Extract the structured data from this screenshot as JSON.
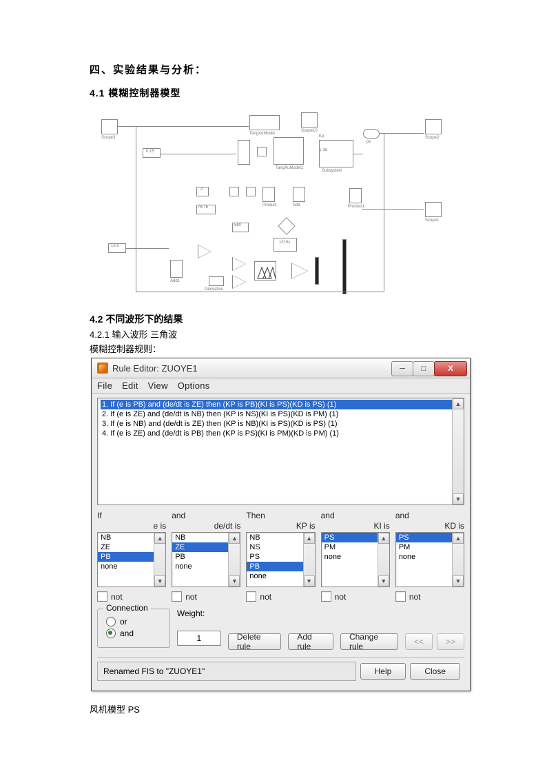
{
  "headings": {
    "section4": "四、实验结果与分析：",
    "s41": "4.1 模糊控制器模型",
    "s42": "4.2 不同波形下的结果",
    "s421": "4.2.1 输入波形 三角波",
    "ruleLabel": "模糊控制器规则：",
    "footer": "风机模型  PS"
  },
  "diagram_labels": {
    "scope3": "Scope3",
    "scope2": "Scope2",
    "scope1": "Scope1",
    "scope10": "Scope10",
    "add": "Add",
    "add1": "Add1",
    "product": "Product",
    "product1": "Product1",
    "derivative": "Derivative",
    "subsystem": "Subsystem",
    "kp": "Kp",
    "u3d": "u·3d",
    "const": "2",
    "const2": "76.76",
    "const3": "580",
    "const4": "0.15",
    "const5": "16.6",
    "tf": "1/0.5s",
    "tangxumodel": "TangXuModel",
    "tangxumodel1": "TangXuModel1",
    "pv": "pv"
  },
  "dialog": {
    "title": "Rule Editor: ZUOYE1",
    "menus": [
      "File",
      "Edit",
      "View",
      "Options"
    ],
    "win": {
      "min": "─",
      "max": "□",
      "close": "X"
    },
    "rules": [
      "1. If (e is PB) and (de/dt is ZE) then (KP is PB)(KI is PS)(KD is PS) (1)",
      "2. If (e is ZE) and (de/dt is NB) then (KP is NS)(KI is PS)(KD is PM) (1)",
      "3. If (e is NB) and (de/dt is ZE) then (KP is NB)(KI is PS)(KD is PS) (1)",
      "4. If (e is ZE) and (de/dt is PB) then (KP is PS)(KI is PM)(KD is PM) (1)"
    ],
    "ruleSelected": 0,
    "cols": [
      {
        "top": "If",
        "sub": "e is",
        "items": [
          "NB",
          "ZE",
          "PB",
          "none"
        ],
        "sel": [
          "PB"
        ]
      },
      {
        "top": "and",
        "sub": "de/dt is",
        "items": [
          "NB",
          "ZE",
          "PB",
          "none"
        ],
        "sel": [
          "ZE"
        ]
      },
      {
        "top": "Then",
        "sub": "KP is",
        "items": [
          "NB",
          "NS",
          "PS",
          "PB",
          "none"
        ],
        "sel": [
          "PB"
        ]
      },
      {
        "top": "and",
        "sub": "KI is",
        "items": [
          "PS",
          "PM",
          "none"
        ],
        "sel": [
          "PS"
        ]
      },
      {
        "top": "and",
        "sub": "KD is",
        "items": [
          "PS",
          "PM",
          "none"
        ],
        "sel": [
          "PS"
        ]
      }
    ],
    "not": "not",
    "connection": {
      "legend": "Connection",
      "or": "or",
      "and": "and",
      "selected": "and"
    },
    "weight": {
      "label": "Weight:",
      "value": "1"
    },
    "buttons": {
      "delete": "Delete rule",
      "add": "Add rule",
      "change": "Change rule",
      "prev": "<<",
      "next": ">>",
      "help": "Help",
      "close": "Close"
    },
    "status": "Renamed FIS to \"ZUOYE1\""
  }
}
